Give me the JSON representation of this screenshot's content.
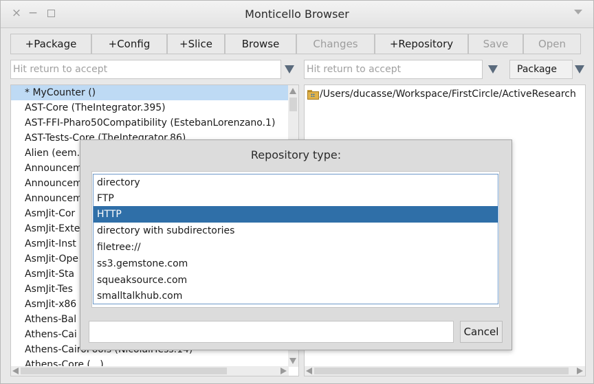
{
  "window": {
    "title": "Monticello Browser"
  },
  "toolbar": {
    "buttons": [
      {
        "label": "+Package",
        "enabled": true
      },
      {
        "label": "+Config",
        "enabled": true
      },
      {
        "label": "+Slice",
        "enabled": true
      },
      {
        "label": "Browse",
        "enabled": true
      },
      {
        "label": "Changes",
        "enabled": false
      },
      {
        "label": "+Repository",
        "enabled": true
      },
      {
        "label": "Save",
        "enabled": false
      },
      {
        "label": "Open",
        "enabled": false
      }
    ]
  },
  "left_filter": {
    "placeholder": "Hit return to accept"
  },
  "right_filter": {
    "placeholder": "Hit return to accept"
  },
  "type_select": {
    "value": "Package"
  },
  "packages": {
    "items": [
      "* MyCounter ()",
      "AST-Core (TheIntegrator.395)",
      "AST-FFI-Pharo50Compatibility (EstebanLorenzano.1)",
      "AST-Tests-Core (TheIntegrator.86)",
      "Alien (eem.",
      "Announcem",
      "Announcem",
      "Announcem",
      "AsmJit-Cor",
      "AsmJit-Exte",
      "AsmJit-Inst",
      "AsmJit-Ope",
      "AsmJit-Sta",
      "AsmJit-Tes",
      "AsmJit-x86",
      "Athens-Bal",
      "Athens-Cai",
      "Athens-CairoPools (NicolaiHess.14)",
      "Athens-Core (...)"
    ],
    "selected_index": 0
  },
  "repositories": {
    "items": [
      "/Users/ducasse/Workspace/FirstCircle/ActiveResearch"
    ]
  },
  "dialog": {
    "title": "Repository type:",
    "options": [
      "directory",
      "FTP",
      "HTTP",
      "directory with subdirectories",
      "filetree://",
      "ss3.gemstone.com",
      "squeaksource.com",
      "smalltalkhub.com"
    ],
    "selected_index": 2,
    "input_value": "",
    "cancel_label": "Cancel"
  },
  "colors": {
    "selection_light": "#bedaf4",
    "selection_dark": "#2f6fa8",
    "dropdown_arrow": "#5a6a7c"
  }
}
